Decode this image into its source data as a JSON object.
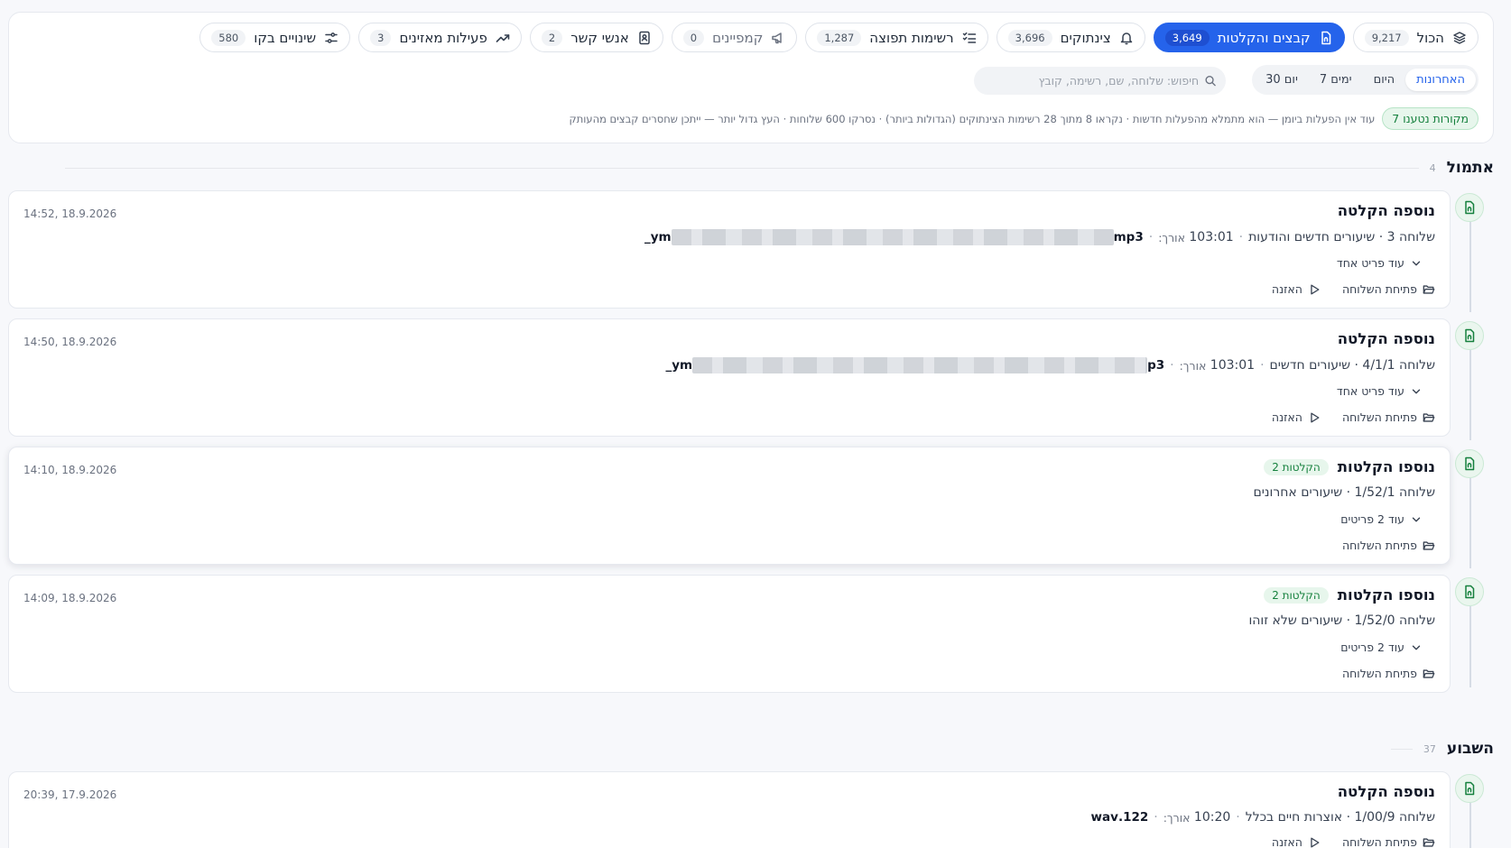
{
  "tabs": [
    {
      "label": "הכול",
      "count": "9,217",
      "icon": "layers-icon"
    },
    {
      "label": "קבצים והקלטות",
      "count": "3,649",
      "icon": "file-audio-icon",
      "active": true
    },
    {
      "label": "צינתוקים",
      "count": "3,696",
      "icon": "bell-icon"
    },
    {
      "label": "רשימות תפוצה",
      "count": "1,287",
      "icon": "list-checks-icon"
    },
    {
      "label": "קמפיינים",
      "count": "0",
      "icon": "megaphone-icon",
      "muted": true
    },
    {
      "label": "אנשי קשר",
      "count": "2",
      "icon": "contact-book-icon"
    },
    {
      "label": "פעילות מאזינים",
      "count": "3",
      "icon": "trending-up-icon"
    },
    {
      "label": "שינויים בקו",
      "count": "580",
      "icon": "sliders-icon"
    }
  ],
  "range": {
    "options": [
      "האחרונות",
      "היום",
      "7 ימים",
      "30 יום"
    ],
    "selected": "האחרונות"
  },
  "search": {
    "placeholder": "חיפוש: שלוחה, שם, רשימה, קובץ"
  },
  "sources": {
    "badge": "7 מקורות נטענו",
    "note": "עוד אין הפעלות ביומן — הוא מתמלא מהפעלות חדשות · נקראו 8 מתוך 28 רשימות הצינתוקים (הגדולות ביותר) · נסרקו 600 שלוחות · העץ גדול יותר — ייתכן שחסרים קבצים מהעותק"
  },
  "sections": [
    {
      "title": "אתמול",
      "count": "4"
    },
    {
      "title": "השבוע",
      "count": "37"
    }
  ],
  "cards": [
    {
      "title": "נוספה הקלטה",
      "time": "14:52, 18.9.2026",
      "file_prefix": "ym_",
      "file_suffix": "mp3",
      "length_label": "אורך:",
      "length": "103:01",
      "path": "שלוחה 3 · שיעורים חדשים והודעות",
      "more": "עוד פריט אחד",
      "open": "פתיחת השלוחה",
      "listen": "האזנה"
    },
    {
      "title": "נוספה הקלטה",
      "time": "14:50, 18.9.2026",
      "file_prefix": "ym_",
      "file_suffix": "p3",
      "length_label": "אורך:",
      "length": "103:01",
      "path": "שלוחה 4/1/1 · שיעורים חדשים",
      "more": "עוד פריט אחד",
      "open": "פתיחת השלוחה",
      "listen": "האזנה"
    },
    {
      "title": "נוספו הקלטות",
      "badge": "2 הקלטות",
      "time": "14:10, 18.9.2026",
      "path": "שלוחה 1/52/1 · שיעורים אחרונים",
      "more": "עוד 2 פריטים",
      "open": "פתיחת השלוחה"
    },
    {
      "title": "נוספו הקלטות",
      "badge": "2 הקלטות",
      "time": "14:09, 18.9.2026",
      "path": "שלוחה 1/52/0 · שיעורים שלא זוהו",
      "more": "עוד 2 פריטים",
      "open": "פתיחת השלוחה"
    },
    {
      "title": "נוספה הקלטה",
      "time": "20:39, 17.9.2026",
      "file": "122.wav",
      "length_label": "אורך:",
      "length": "10:20",
      "path": "שלוחה 1/00/9 · אוצרות חיים בכלל",
      "open": "פתיחת השלוחה",
      "listen": "האזנה"
    }
  ],
  "colors": {
    "accent": "#2563eb",
    "success": "#15803d",
    "success_bg": "#e7f6ec"
  }
}
